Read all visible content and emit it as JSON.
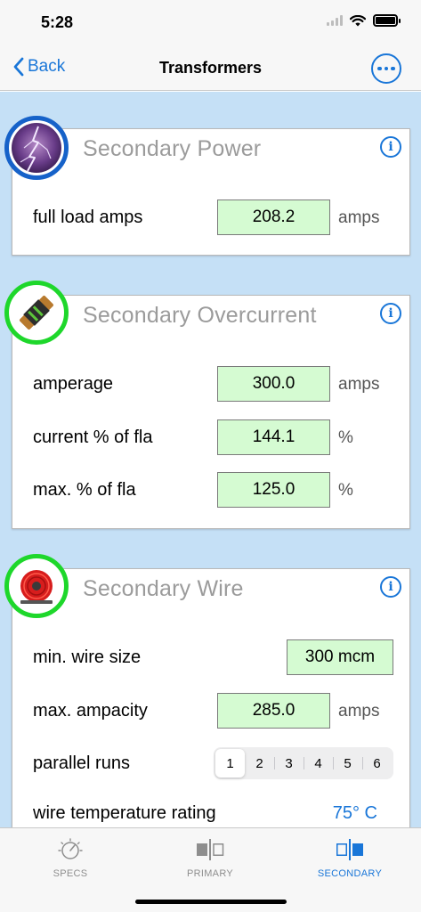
{
  "status_bar": {
    "time": "5:28"
  },
  "nav": {
    "back_label": "Back",
    "title": "Transformers"
  },
  "cards": {
    "power": {
      "title": "Secondary Power",
      "rows": [
        {
          "label": "full load amps",
          "value": "208.2",
          "unit": "amps"
        }
      ]
    },
    "overcurrent": {
      "title": "Secondary Overcurrent",
      "rows": [
        {
          "label": "amperage",
          "value": "300.0",
          "unit": "amps"
        },
        {
          "label": "current % of fla",
          "value": "144.1",
          "unit": "%"
        },
        {
          "label": "max. % of fla",
          "value": "125.0",
          "unit": "%"
        }
      ]
    },
    "wire": {
      "title": "Secondary Wire",
      "min_wire": {
        "label": "min. wire size",
        "value": "300 mcm"
      },
      "max_ampacity": {
        "label": "max. ampacity",
        "value": "285.0",
        "unit": "amps"
      },
      "parallel_runs": {
        "label": "parallel runs",
        "options": [
          "1",
          "2",
          "3",
          "4",
          "5",
          "6"
        ],
        "selected": "1"
      },
      "temp_rating": {
        "label": "wire temperature rating",
        "value": "75° C"
      }
    }
  },
  "tabs": [
    {
      "label": "SPECS",
      "icon": "gauge-icon"
    },
    {
      "label": "PRIMARY",
      "icon": "primary-icon"
    },
    {
      "label": "SECONDARY",
      "icon": "secondary-icon",
      "active": true
    }
  ],
  "colors": {
    "accent": "#1976d8",
    "value_bg": "#d5fbd2",
    "content_bg": "#c5e0f6",
    "badge_blue": "#1662c9",
    "badge_green": "#1ed72b"
  }
}
